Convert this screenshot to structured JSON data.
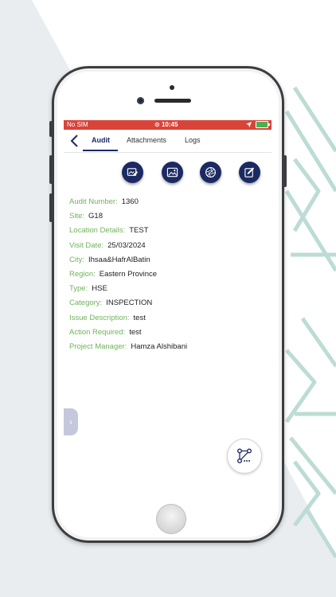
{
  "status_bar": {
    "carrier": "No SIM",
    "time": "10:45"
  },
  "tabs": [
    {
      "label": "Audit",
      "active": true
    },
    {
      "label": "Attachments",
      "active": false
    },
    {
      "label": "Logs",
      "active": false
    }
  ],
  "actions": [
    {
      "icon": "edit-image-icon"
    },
    {
      "icon": "gallery-icon"
    },
    {
      "icon": "camera-aperture-icon"
    },
    {
      "icon": "edit-icon"
    }
  ],
  "fields": [
    {
      "label": "Audit Number:",
      "value": "1360"
    },
    {
      "label": "Site:",
      "value": "G18"
    },
    {
      "label": "Location Details:",
      "value": "TEST"
    },
    {
      "label": "Visit Date:",
      "value": "25/03/2024"
    },
    {
      "label": "City:",
      "value": "Ihsaa&HafrAlBatin"
    },
    {
      "label": "Region:",
      "value": "Eastern Province"
    },
    {
      "label": "Type:",
      "value": "HSE"
    },
    {
      "label": "Category:",
      "value": "INSPECTION"
    },
    {
      "label": "Issue Description:",
      "value": "test"
    },
    {
      "label": "Action Required:",
      "value": "test"
    },
    {
      "label": "Project Manager:",
      "value": "Hamza Alshibani"
    }
  ],
  "drawer_handle": {
    "glyph": "›"
  },
  "colors": {
    "accent": "#1c2a63",
    "status_bar": "#d9443a",
    "label_green": "#6fb35a",
    "deco_teal": "#bcdcd5"
  }
}
